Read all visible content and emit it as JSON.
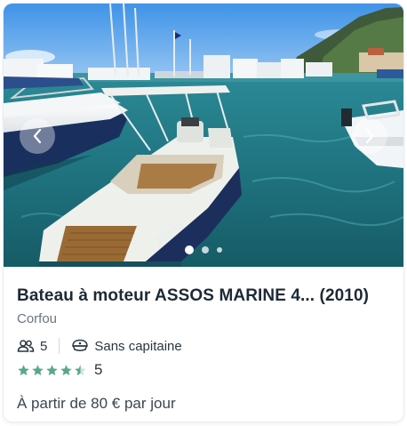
{
  "listing": {
    "title": "Bateau à moteur ASSOS MARINE 4... (2010)",
    "location": "Corfou",
    "capacity": "5",
    "captain": "Sans capitaine",
    "rating_value": "5",
    "stars_filled": 4.5,
    "price": "À partir de 80 € par jour"
  },
  "carousel": {
    "slide_count": 3,
    "active_index": 0
  },
  "icons": {
    "prev": "chevron-left-icon",
    "next": "chevron-right-icon",
    "capacity": "people-icon",
    "captain": "captain-hat-icon",
    "star": "star-icon"
  },
  "colors": {
    "star": "#5aa88c",
    "title": "#1d2a35",
    "muted": "#6b7580"
  }
}
